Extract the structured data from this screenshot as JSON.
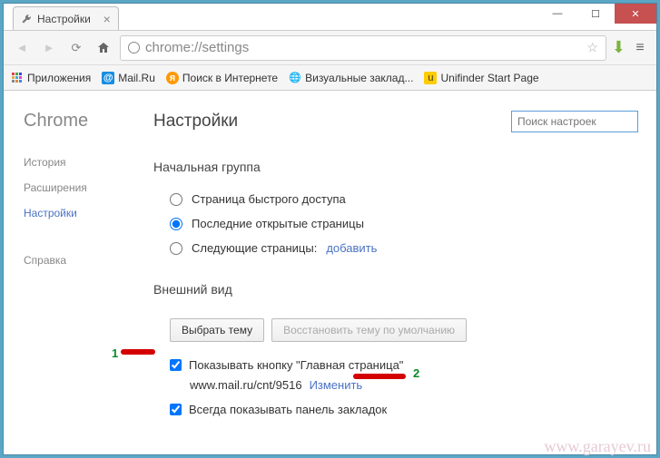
{
  "window": {
    "tab_title": "Настройки",
    "url": "chrome://settings"
  },
  "bookmarks": {
    "apps": "Приложения",
    "mailru": "Mail.Ru",
    "search": "Поиск в Интернете",
    "visual": "Визуальные заклад...",
    "unifinder": "Unifinder Start Page"
  },
  "sidebar": {
    "brand": "Chrome",
    "history": "История",
    "extensions": "Расширения",
    "settings": "Настройки",
    "help": "Справка"
  },
  "page": {
    "title": "Настройки",
    "search_placeholder": "Поиск настроек"
  },
  "startup": {
    "heading": "Начальная группа",
    "opt1": "Страница быстрого доступа",
    "opt2": "Последние открытые страницы",
    "opt3": "Следующие страницы:",
    "add_link": "добавить"
  },
  "appearance": {
    "heading": "Внешний вид",
    "choose_theme": "Выбрать тему",
    "reset_theme": "Восстановить тему по умолчанию",
    "show_home": "Показывать кнопку \"Главная страница\"",
    "home_url": "www.mail.ru/cnt/9516",
    "change": "Изменить",
    "show_bookmarks": "Всегда показывать панель закладок"
  },
  "annotations": {
    "one": "1",
    "two": "2"
  },
  "watermark": "www.garayev.ru"
}
